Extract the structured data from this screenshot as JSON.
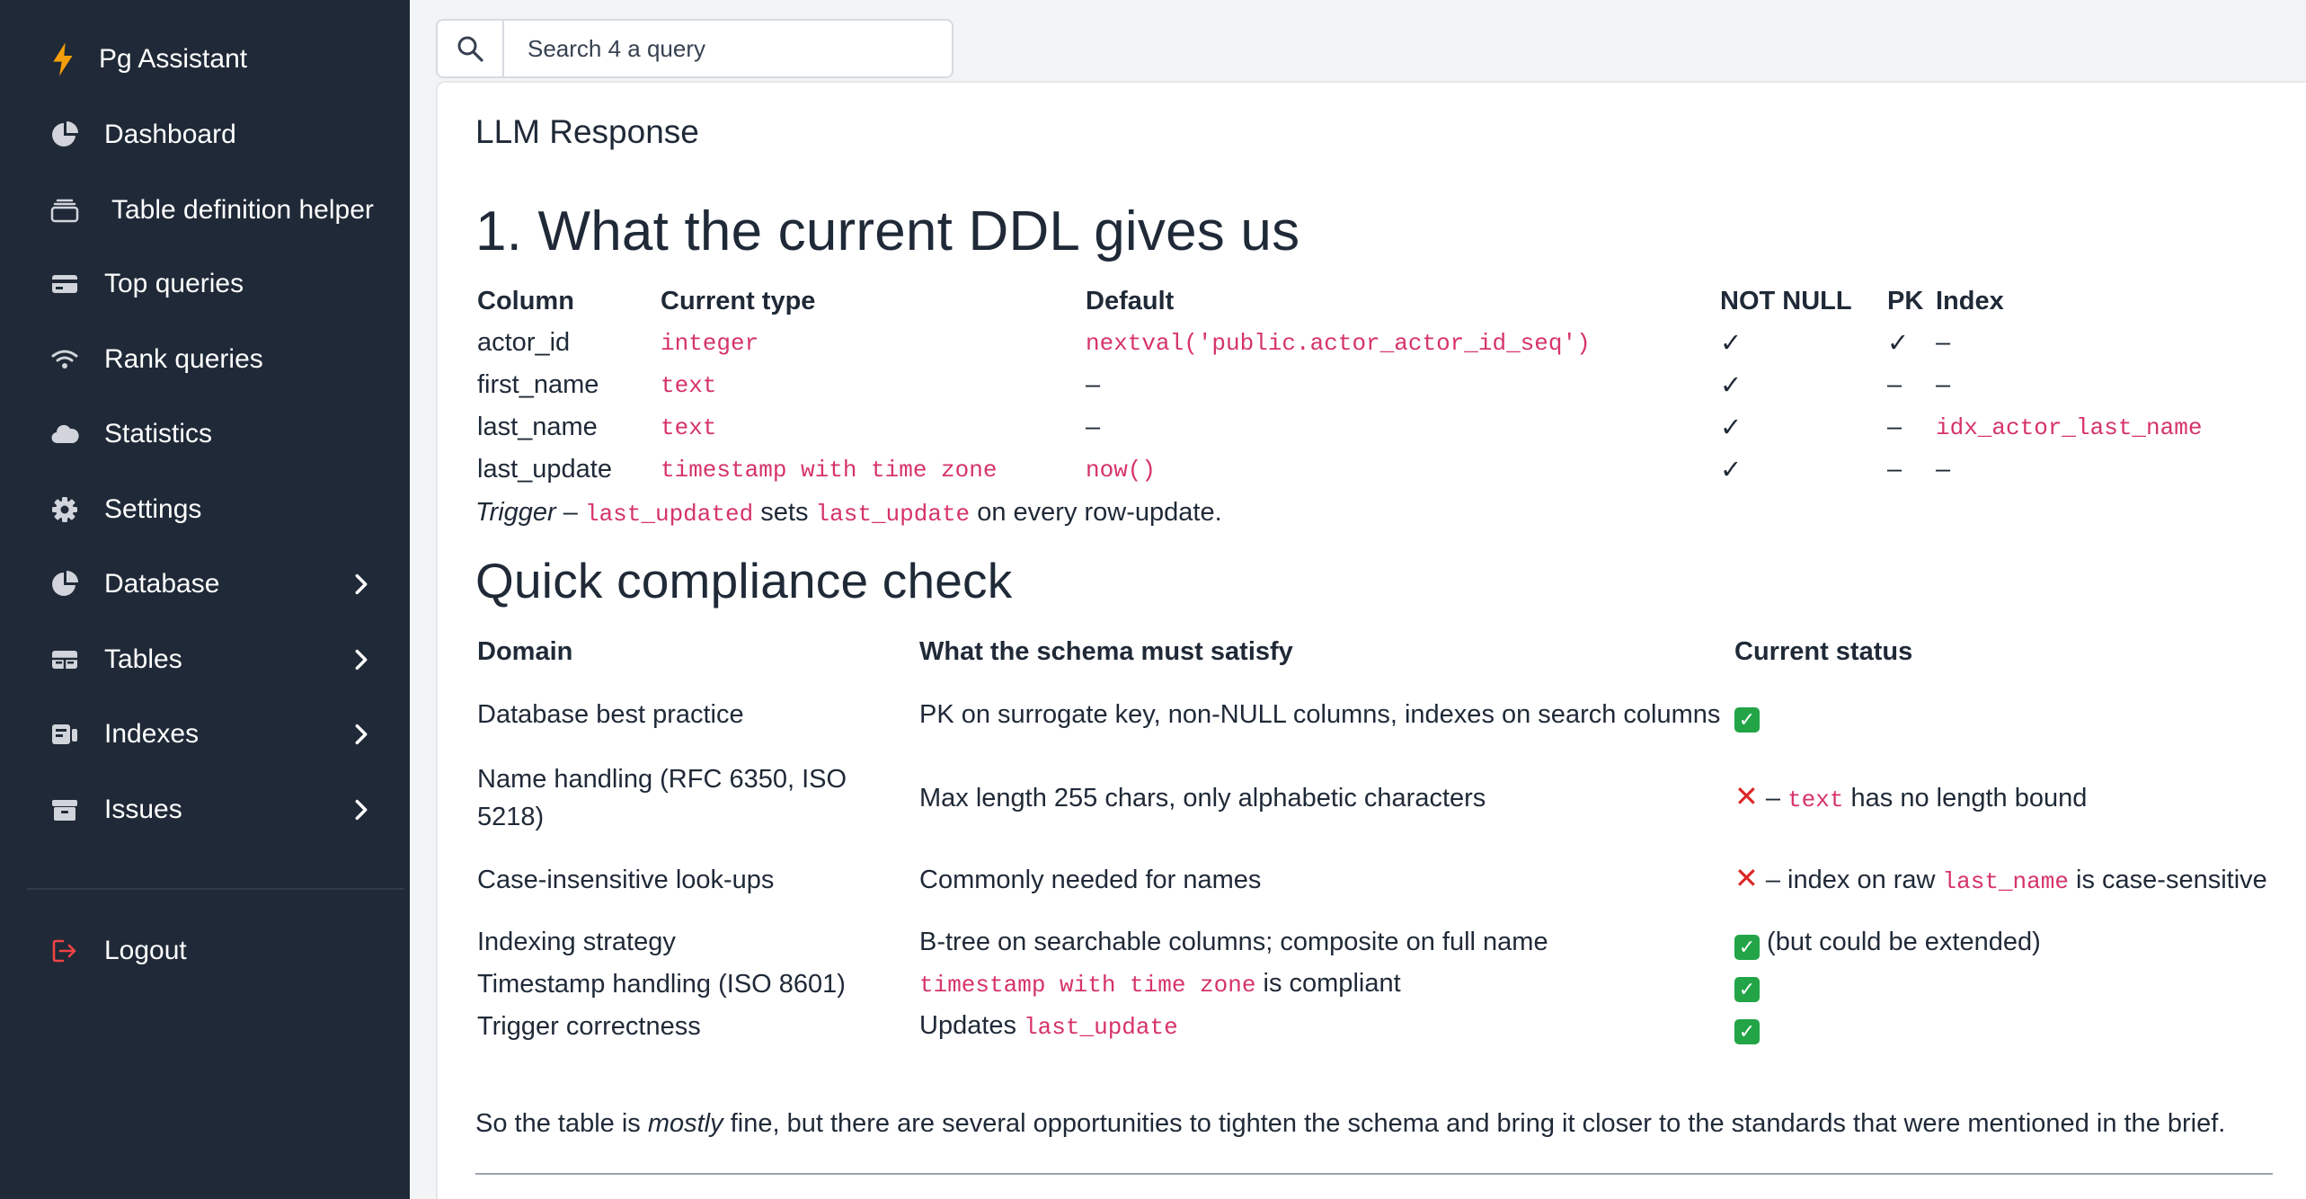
{
  "app": {
    "name": "Pg Assistant"
  },
  "sidebar": {
    "items": [
      {
        "label": "Dashboard",
        "icon": "pie-chart-icon"
      },
      {
        "label": "Table definition helper",
        "icon": "stack-icon"
      },
      {
        "label": "Top queries",
        "icon": "card-icon"
      },
      {
        "label": "Rank queries",
        "icon": "wifi-icon"
      },
      {
        "label": "Statistics",
        "icon": "cloud-icon"
      },
      {
        "label": "Settings",
        "icon": "gear-icon"
      },
      {
        "label": "Database",
        "icon": "pie-chart-icon",
        "has_submenu": true
      },
      {
        "label": "Tables",
        "icon": "table-icon",
        "has_submenu": true
      },
      {
        "label": "Indexes",
        "icon": "index-icon",
        "has_submenu": true
      },
      {
        "label": "Issues",
        "icon": "archive-icon",
        "has_submenu": true
      }
    ],
    "logout": {
      "label": "Logout",
      "icon": "logout-icon",
      "color": "#ef4444"
    }
  },
  "search": {
    "placeholder": "Search 4 a query"
  },
  "card": {
    "title": "LLM Response"
  },
  "section1": {
    "heading": "1. What the current DDL gives us",
    "headers": [
      "Column",
      "Current type",
      "Default",
      "NOT NULL",
      "PK",
      "Index"
    ],
    "rows": [
      {
        "column": "actor_id",
        "type": "integer",
        "default": "nextval('public.actor_actor_id_seq')",
        "not_null": "✓",
        "pk": "✓",
        "index": "–"
      },
      {
        "column": "first_name",
        "type": "text",
        "default": "–",
        "not_null": "✓",
        "pk": "–",
        "index": "–"
      },
      {
        "column": "last_name",
        "type": "text",
        "default": "–",
        "not_null": "✓",
        "pk": "–",
        "index": "idx_actor_last_name"
      },
      {
        "column": "last_update",
        "type": "timestamp with time zone",
        "default": "now()",
        "not_null": "✓",
        "pk": "–",
        "index": "–"
      }
    ],
    "trigger_note": {
      "label": "Trigger",
      "dash": " – ",
      "trigger_name": "last_updated",
      "mid": " sets ",
      "column": "last_update",
      "end": " on every row-update."
    }
  },
  "section2": {
    "heading": "Quick compliance check",
    "headers": [
      "Domain",
      "What the schema must satisfy",
      "Current status"
    ],
    "rows": {
      "r1": {
        "domain": "Database best practice",
        "requirement": "PK on surrogate key, non-NULL columns, indexes on search columns",
        "status_icon": "✓"
      },
      "r2": {
        "domain": "Name handling (RFC 6350, ISO 5218)",
        "requirement": "Max length 255 chars, only alphabetic characters",
        "status_icon": "✕",
        "status_pre": " – ",
        "status_code": "text",
        "status_post": " has no length bound"
      },
      "r3": {
        "domain": "Case-insensitive look-ups",
        "requirement": "Commonly needed for names",
        "status_icon": "✕",
        "status_pre": " – index on raw ",
        "status_code": "last_name",
        "status_post": " is case-sensitive"
      },
      "r4": {
        "domain": "Indexing strategy",
        "requirement": "B-tree on searchable columns; composite on full name",
        "status_icon": "✓",
        "status_post": " (but could be extended)"
      },
      "r5": {
        "domain": "Timestamp handling (ISO 8601)",
        "requirement_code": "timestamp with time zone",
        "requirement_post": " is compliant",
        "status_icon": "✓"
      },
      "r6": {
        "domain": "Trigger correctness",
        "requirement_pre": "Updates ",
        "requirement_code": "last_update",
        "status_icon": "✓"
      }
    },
    "summary": {
      "pre": "So the table is ",
      "emphasis": "mostly",
      "post": " fine, but there are several opportunities to tighten the schema and bring it closer to the standards that were mentioned in the brief."
    }
  },
  "colors": {
    "sidebar_bg": "#1f2937",
    "code": "#d6336c",
    "check_green": "#22a447",
    "cross_red": "#dc2626"
  }
}
